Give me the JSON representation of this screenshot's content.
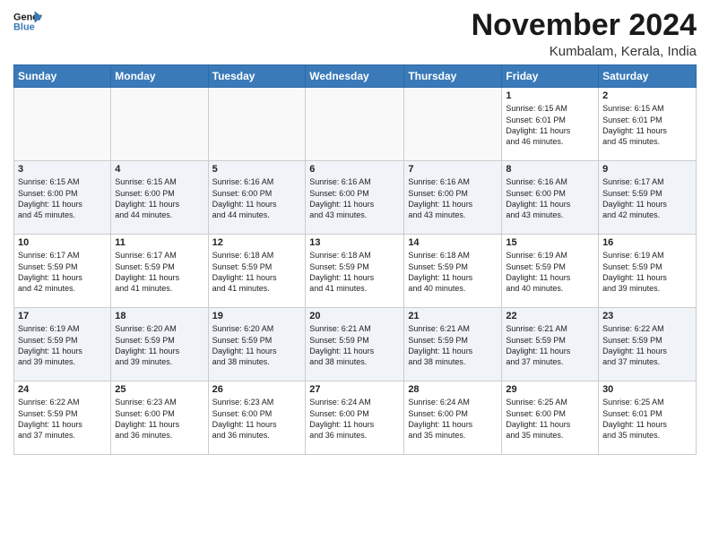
{
  "header": {
    "logo_line1": "General",
    "logo_line2": "Blue",
    "month": "November 2024",
    "location": "Kumbalam, Kerala, India"
  },
  "weekdays": [
    "Sunday",
    "Monday",
    "Tuesday",
    "Wednesday",
    "Thursday",
    "Friday",
    "Saturday"
  ],
  "weeks": [
    [
      {
        "day": "",
        "info": ""
      },
      {
        "day": "",
        "info": ""
      },
      {
        "day": "",
        "info": ""
      },
      {
        "day": "",
        "info": ""
      },
      {
        "day": "",
        "info": ""
      },
      {
        "day": "1",
        "info": "Sunrise: 6:15 AM\nSunset: 6:01 PM\nDaylight: 11 hours\nand 46 minutes."
      },
      {
        "day": "2",
        "info": "Sunrise: 6:15 AM\nSunset: 6:01 PM\nDaylight: 11 hours\nand 45 minutes."
      }
    ],
    [
      {
        "day": "3",
        "info": "Sunrise: 6:15 AM\nSunset: 6:00 PM\nDaylight: 11 hours\nand 45 minutes."
      },
      {
        "day": "4",
        "info": "Sunrise: 6:15 AM\nSunset: 6:00 PM\nDaylight: 11 hours\nand 44 minutes."
      },
      {
        "day": "5",
        "info": "Sunrise: 6:16 AM\nSunset: 6:00 PM\nDaylight: 11 hours\nand 44 minutes."
      },
      {
        "day": "6",
        "info": "Sunrise: 6:16 AM\nSunset: 6:00 PM\nDaylight: 11 hours\nand 43 minutes."
      },
      {
        "day": "7",
        "info": "Sunrise: 6:16 AM\nSunset: 6:00 PM\nDaylight: 11 hours\nand 43 minutes."
      },
      {
        "day": "8",
        "info": "Sunrise: 6:16 AM\nSunset: 6:00 PM\nDaylight: 11 hours\nand 43 minutes."
      },
      {
        "day": "9",
        "info": "Sunrise: 6:17 AM\nSunset: 5:59 PM\nDaylight: 11 hours\nand 42 minutes."
      }
    ],
    [
      {
        "day": "10",
        "info": "Sunrise: 6:17 AM\nSunset: 5:59 PM\nDaylight: 11 hours\nand 42 minutes."
      },
      {
        "day": "11",
        "info": "Sunrise: 6:17 AM\nSunset: 5:59 PM\nDaylight: 11 hours\nand 41 minutes."
      },
      {
        "day": "12",
        "info": "Sunrise: 6:18 AM\nSunset: 5:59 PM\nDaylight: 11 hours\nand 41 minutes."
      },
      {
        "day": "13",
        "info": "Sunrise: 6:18 AM\nSunset: 5:59 PM\nDaylight: 11 hours\nand 41 minutes."
      },
      {
        "day": "14",
        "info": "Sunrise: 6:18 AM\nSunset: 5:59 PM\nDaylight: 11 hours\nand 40 minutes."
      },
      {
        "day": "15",
        "info": "Sunrise: 6:19 AM\nSunset: 5:59 PM\nDaylight: 11 hours\nand 40 minutes."
      },
      {
        "day": "16",
        "info": "Sunrise: 6:19 AM\nSunset: 5:59 PM\nDaylight: 11 hours\nand 39 minutes."
      }
    ],
    [
      {
        "day": "17",
        "info": "Sunrise: 6:19 AM\nSunset: 5:59 PM\nDaylight: 11 hours\nand 39 minutes."
      },
      {
        "day": "18",
        "info": "Sunrise: 6:20 AM\nSunset: 5:59 PM\nDaylight: 11 hours\nand 39 minutes."
      },
      {
        "day": "19",
        "info": "Sunrise: 6:20 AM\nSunset: 5:59 PM\nDaylight: 11 hours\nand 38 minutes."
      },
      {
        "day": "20",
        "info": "Sunrise: 6:21 AM\nSunset: 5:59 PM\nDaylight: 11 hours\nand 38 minutes."
      },
      {
        "day": "21",
        "info": "Sunrise: 6:21 AM\nSunset: 5:59 PM\nDaylight: 11 hours\nand 38 minutes."
      },
      {
        "day": "22",
        "info": "Sunrise: 6:21 AM\nSunset: 5:59 PM\nDaylight: 11 hours\nand 37 minutes."
      },
      {
        "day": "23",
        "info": "Sunrise: 6:22 AM\nSunset: 5:59 PM\nDaylight: 11 hours\nand 37 minutes."
      }
    ],
    [
      {
        "day": "24",
        "info": "Sunrise: 6:22 AM\nSunset: 5:59 PM\nDaylight: 11 hours\nand 37 minutes."
      },
      {
        "day": "25",
        "info": "Sunrise: 6:23 AM\nSunset: 6:00 PM\nDaylight: 11 hours\nand 36 minutes."
      },
      {
        "day": "26",
        "info": "Sunrise: 6:23 AM\nSunset: 6:00 PM\nDaylight: 11 hours\nand 36 minutes."
      },
      {
        "day": "27",
        "info": "Sunrise: 6:24 AM\nSunset: 6:00 PM\nDaylight: 11 hours\nand 36 minutes."
      },
      {
        "day": "28",
        "info": "Sunrise: 6:24 AM\nSunset: 6:00 PM\nDaylight: 11 hours\nand 35 minutes."
      },
      {
        "day": "29",
        "info": "Sunrise: 6:25 AM\nSunset: 6:00 PM\nDaylight: 11 hours\nand 35 minutes."
      },
      {
        "day": "30",
        "info": "Sunrise: 6:25 AM\nSunset: 6:01 PM\nDaylight: 11 hours\nand 35 minutes."
      }
    ]
  ]
}
